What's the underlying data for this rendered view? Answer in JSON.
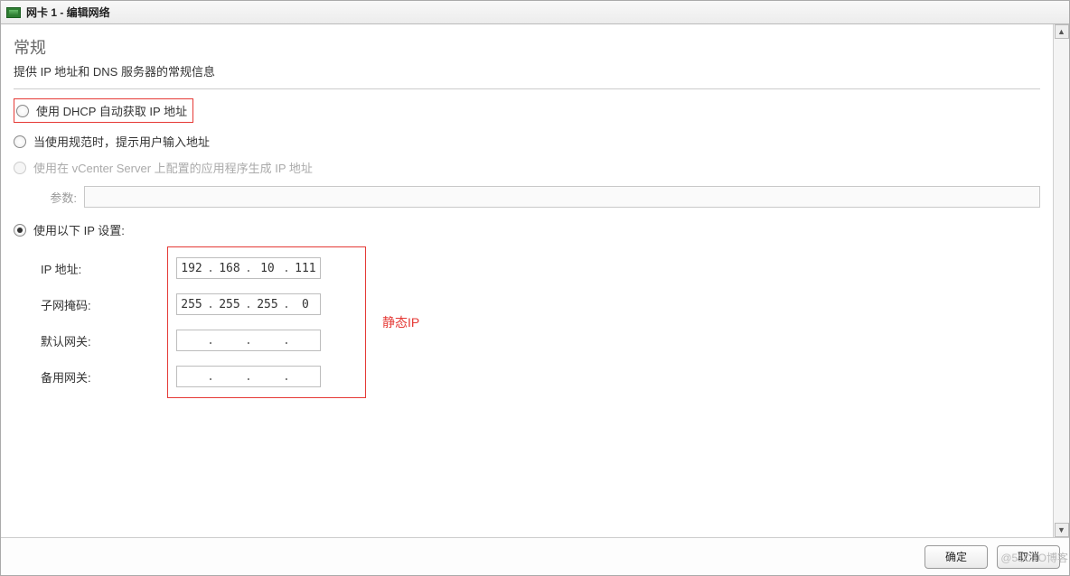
{
  "titlebar": {
    "title": "网卡 1 - 编辑网络"
  },
  "section": {
    "title": "常规",
    "subtitle": "提供 IP 地址和 DNS 服务器的常规信息"
  },
  "options": {
    "dhcp": "使用 DHCP 自动获取 IP 地址",
    "prompt": "当使用规范时，提示用户输入地址",
    "vcenter": "使用在 vCenter Server 上配置的应用程序生成 IP 地址",
    "param_label": "参数:",
    "static": "使用以下 IP 设置:"
  },
  "static": {
    "labels": {
      "ip": "IP 地址:",
      "mask": "子网掩码:",
      "gateway": "默认网关:",
      "alt_gateway": "备用网关:"
    },
    "ip": [
      "192",
      "168",
      "10",
      "111"
    ],
    "mask": [
      "255",
      "255",
      "255",
      "0"
    ],
    "gateway": [
      "",
      "",
      "",
      ""
    ],
    "alt_gateway": [
      "",
      "",
      "",
      ""
    ]
  },
  "annotation": {
    "static_ip": "静态IP"
  },
  "footer": {
    "ok": "确定",
    "cancel": "取消"
  },
  "watermark": "@51CTO博客"
}
